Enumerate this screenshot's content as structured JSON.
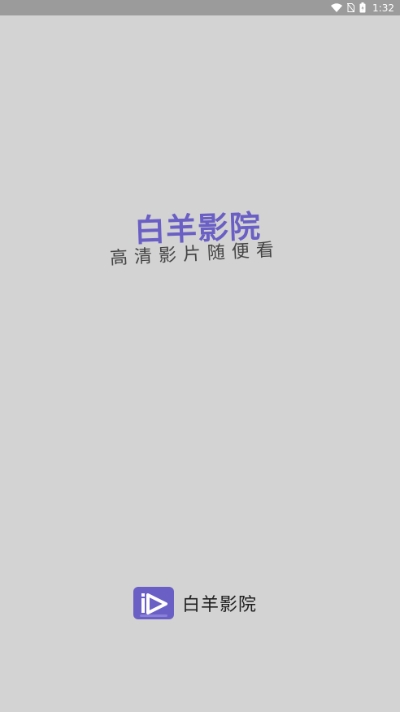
{
  "status_bar": {
    "time": "1:32",
    "icons": [
      "wifi-icon",
      "no-sim-icon",
      "battery-icon"
    ]
  },
  "splash": {
    "title": "白羊影院",
    "slogan": "高清影片随便看"
  },
  "brand": {
    "name": "白羊影院",
    "logo_icon": "play-logo-icon"
  },
  "colors": {
    "background": "#d3d3d3",
    "status_bar": "#9b9b9b",
    "accent": "#6a5fc4",
    "text": "#1f1f1f"
  }
}
